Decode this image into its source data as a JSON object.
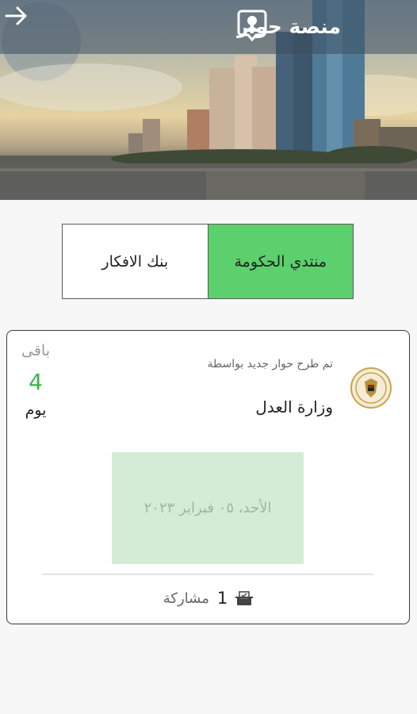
{
  "header": {
    "app_name": "منصة حوار",
    "back_icon": "arrow-right-icon",
    "logo_icon": "chat-person-icon"
  },
  "tabs": [
    {
      "label": "منتدي الحكومة",
      "active": true
    },
    {
      "label": "بنك الافكار",
      "active": false
    }
  ],
  "colors": {
    "accent_green": "#5cd06d",
    "count_green": "#3cb44b",
    "date_box": "#d4ecd6"
  },
  "card": {
    "remaining": {
      "label": "باقى",
      "value": "4",
      "unit": "يوم"
    },
    "intro": "تم طرح حوار جديد بواسطة",
    "ministry": "وزارة العدل",
    "seal_icon": "ministry-seal-icon",
    "date": "الأحد، ٠٥ فبراير ٢٠٢٣",
    "participation": {
      "count": "1",
      "label": "مشاركة",
      "icon": "ballot-box-icon"
    }
  }
}
